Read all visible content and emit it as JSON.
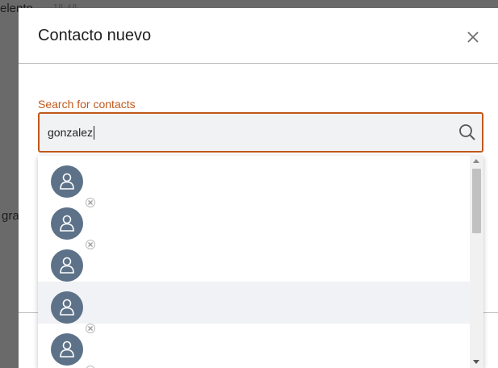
{
  "background": {
    "partial_text_top": "elento",
    "partial_text_mid": "gra",
    "faint_text": "18:48"
  },
  "dialog": {
    "title": "Contacto nuevo",
    "close_icon": "close-icon"
  },
  "search": {
    "label": "Search for contacts",
    "value": "gonzalez",
    "icon": "search-icon",
    "accent_color": "#c1581c"
  },
  "results": [
    {
      "avatar_icon": "person-icon",
      "status_icon": "offline-status-icon",
      "hover": false
    },
    {
      "avatar_icon": "person-icon",
      "status_icon": "offline-status-icon",
      "hover": false
    },
    {
      "avatar_icon": "person-icon",
      "status_icon": "offline-status-icon",
      "hover": false
    },
    {
      "avatar_icon": "person-icon",
      "status_icon": "offline-status-icon",
      "hover": true
    },
    {
      "avatar_icon": "person-icon",
      "status_icon": "offline-status-icon",
      "hover": false
    }
  ]
}
